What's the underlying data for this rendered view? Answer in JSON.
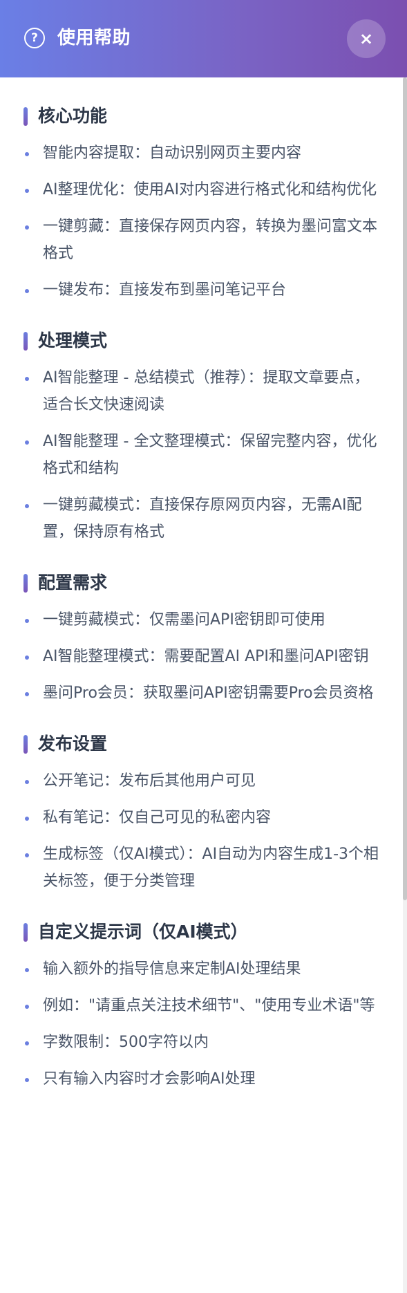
{
  "header": {
    "title": "使用帮助",
    "help_icon": "?",
    "close_icon": "×"
  },
  "sections": [
    {
      "title": "核心功能",
      "items": [
        "智能内容提取：自动识别网页主要内容",
        "AI整理优化：使用AI对内容进行格式化和结构优化",
        "一键剪藏：直接保存网页内容，转换为墨问富文本格式",
        "一键发布：直接发布到墨问笔记平台"
      ]
    },
    {
      "title": "处理模式",
      "items": [
        "AI智能整理 - 总结模式（推荐）：提取文章要点，适合长文快速阅读",
        "AI智能整理 - 全文整理模式：保留完整内容，优化格式和结构",
        "一键剪藏模式：直接保存原网页内容，无需AI配置，保持原有格式"
      ]
    },
    {
      "title": "配置需求",
      "items": [
        "一键剪藏模式：仅需墨问API密钥即可使用",
        "AI智能整理模式：需要配置AI API和墨问API密钥",
        "墨问Pro会员：获取墨问API密钥需要Pro会员资格"
      ]
    },
    {
      "title": "发布设置",
      "items": [
        "公开笔记：发布后其他用户可见",
        "私有笔记：仅自己可见的私密内容",
        "生成标签（仅AI模式）：AI自动为内容生成1-3个相关标签，便于分类管理"
      ]
    },
    {
      "title": "自定义提示词（仅AI模式）",
      "items": [
        "输入额外的指导信息来定制AI处理结果",
        "例如：\"请重点关注技术细节\"、\"使用专业术语\"等",
        "字数限制：500字符以内",
        "只有输入内容时才会影响AI处理"
      ]
    }
  ]
}
